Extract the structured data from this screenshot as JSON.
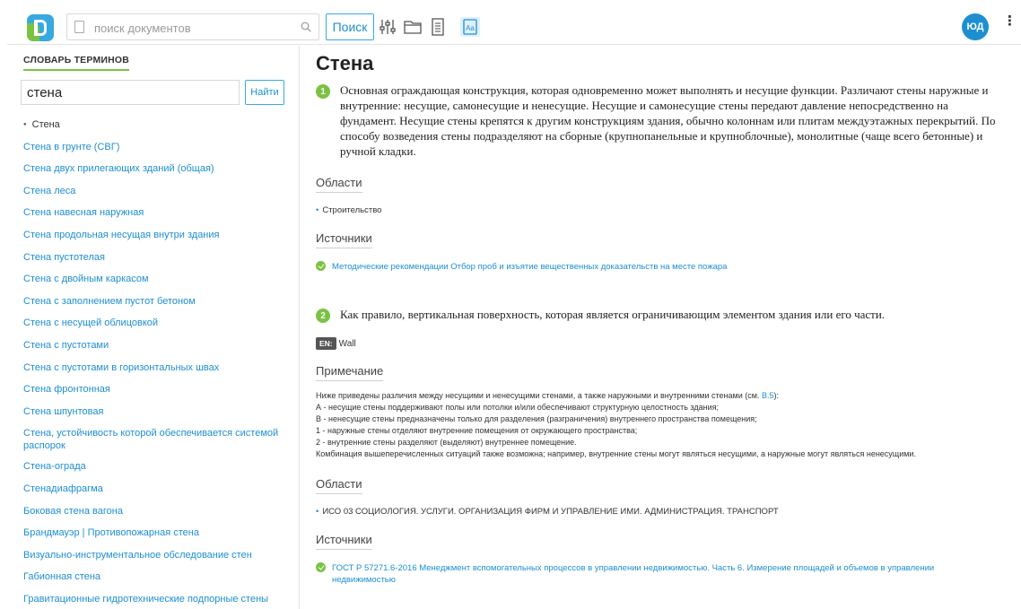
{
  "header": {
    "search_placeholder": "поиск документов",
    "search_button": "Поиск",
    "user_initials": "ЮД",
    "more_glyph": "⋮",
    "tools": [
      "filter-icon",
      "folder-icon",
      "document-icon",
      "dictionary-icon"
    ]
  },
  "sidebar": {
    "title": "СЛОВАРЬ ТЕРМИНОВ",
    "query": "стена",
    "find_button": "Найти",
    "terms": [
      "Стена",
      "Стена в грунте (СВГ)",
      "Стена двух прилегающих зданий (общая)",
      "Стена леса",
      "Стена навесная наружная",
      "Стена продольная несущая внутри здания",
      "Стена пустотелая",
      "Стена с двойным каркасом",
      "Стена с заполнением пустот бетоном",
      "Стена с несущей облицовкой",
      "Стена с пустотами",
      "Стена с пустотами в горизонтальных швах",
      "Стена фронтонная",
      "Стена шпунтовая",
      "Стена, устойчивость которой обеспечивается системой распорок",
      "Стена-ограда",
      "Стенадиафрагма",
      "Боковая стена вагона",
      "Брандмауэр | Противопожарная стена",
      "Визуально-инструментальное обследование стен",
      "Габионная стена",
      "Гравитационные гидротехнические подпорные стены"
    ]
  },
  "main": {
    "title": "Стена",
    "def1": {
      "num": "1",
      "text": "Основная ограждающая конструкция, которая одновременно может выполнять и несущие функции. Различают стены наружные и внутренние: несущие, самонесущие и ненесущие. Несущие и самонесущие стены передают давление непосредственно на фундамент. Несущие стены крепятся к другим конструкциям здания, обычно колоннам или плитам междуэтажных перекрытий. По способу возведения стены подразделяют на сборные (крупнопанельные и крупноблочные), монолитные (чаще всего бетонные) и ручной кладки.",
      "areas_label": "Области",
      "area": "Строительство",
      "sources_label": "Источники",
      "source": "Методические рекомендации Отбор проб и изъятие вещественных доказательств на месте пожара"
    },
    "def2": {
      "num": "2",
      "text": "Как правило, вертикальная поверхность, которая является ограничивающим элементом здания или его части.",
      "lang_code": "EN:",
      "lang_word": "Wall",
      "note_label": "Примечание",
      "note_intro": "Ниже приведены различия между несущими и ненесущими стенами, а также наружными и внутренними стенами (см. ",
      "note_ref": "В.5",
      "note_intro_end": "):",
      "note_lines": [
        "А - несущие стены поддерживают полы или потолки и/или обеспечивают структурную целостность здания;",
        "В - ненесущие стены предназначены только для разделения (разграничения) внутреннего пространства помещения;",
        "1 - наружные стены отделяют внутренние помещения от окружающего пространства;",
        "2 - внутренние стены разделяют (выделяют) внутреннее помещение.",
        "Комбинация вышеперечисленных ситуаций также возможна; например, внутренние стены могут являться несущими, а наружные могут являться ненесущими."
      ],
      "areas_label": "Области",
      "area": "ИСО 03 СОЦИОЛОГИЯ. УСЛУГИ. ОРГАНИЗАЦИЯ ФИРМ И УПРАВЛЕНИЕ ИМИ. АДМИНИСТРАЦИЯ. ТРАНСПОРТ",
      "sources_label": "Источники",
      "source": "ГОСТ Р 57271.6-2016 Менеджмент вспомогательных процессов в управлении недвижимостью. Часть 6. Измерение площадей и объемов в управлении недвижимостью"
    }
  }
}
